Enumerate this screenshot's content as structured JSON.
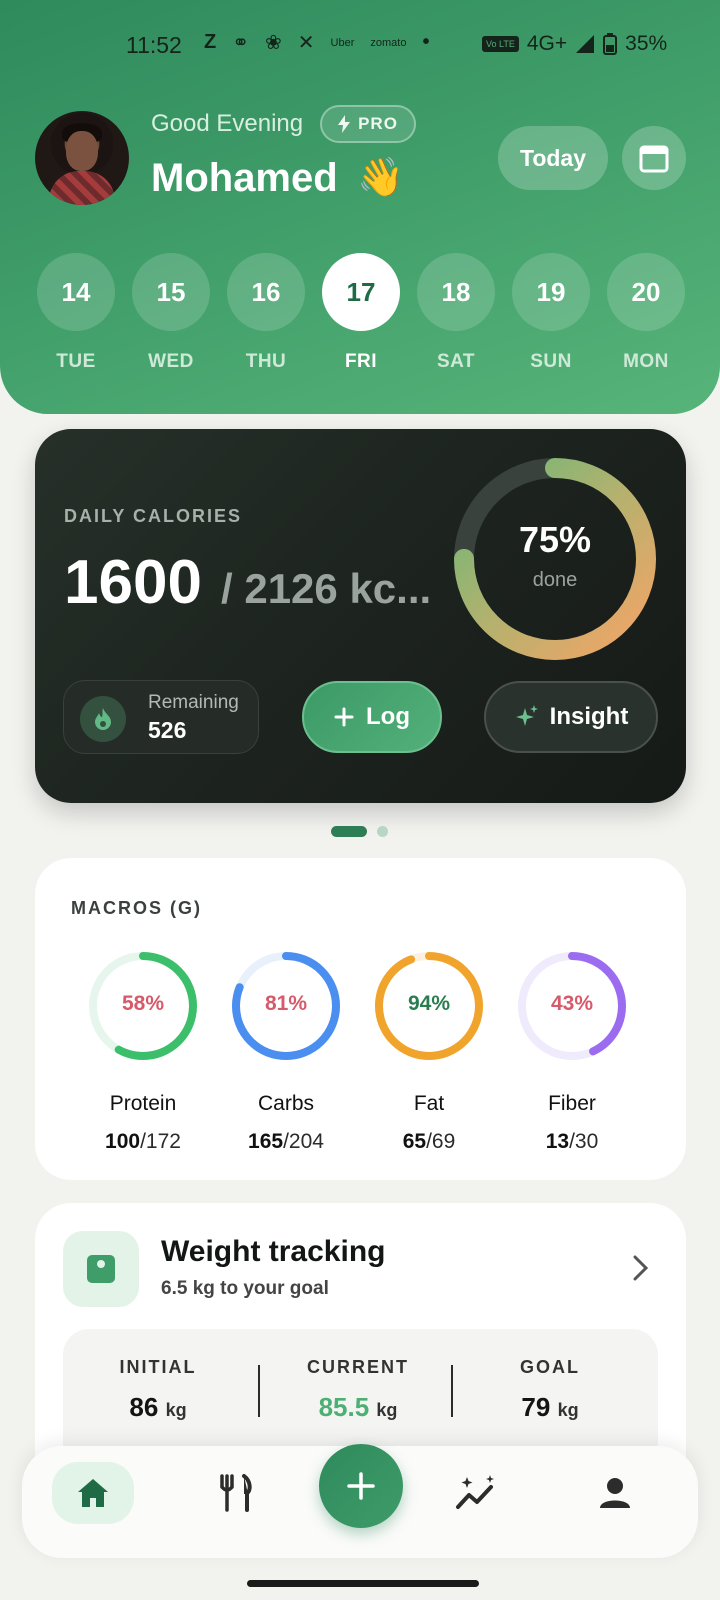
{
  "status_bar": {
    "time": "11:52",
    "apps": [
      "Z",
      "Uber",
      "zomato"
    ],
    "network": "4G+",
    "battery": "35%",
    "volte": "Vo LTE"
  },
  "header": {
    "greeting": "Good Evening",
    "badge": "PRO",
    "user_name": "Mohamed",
    "wave_emoji": "👋",
    "today_label": "Today",
    "days": [
      {
        "num": "14",
        "label": "TUE",
        "selected": false
      },
      {
        "num": "15",
        "label": "WED",
        "selected": false
      },
      {
        "num": "16",
        "label": "THU",
        "selected": false
      },
      {
        "num": "17",
        "label": "FRI",
        "selected": true
      },
      {
        "num": "18",
        "label": "SAT",
        "selected": false
      },
      {
        "num": "19",
        "label": "SUN",
        "selected": false
      },
      {
        "num": "20",
        "label": "MON",
        "selected": false
      }
    ]
  },
  "calories": {
    "label": "DAILY CALORIES",
    "consumed": "1600",
    "goal_text": "/ 2126 kc...",
    "percent_text": "75%",
    "percent_value": 0.75,
    "done_label": "done",
    "remaining_label": "Remaining",
    "remaining_value": "526",
    "log_label": "Log",
    "insight_label": "Insight"
  },
  "macros": {
    "title": "MACROS (G)",
    "items": [
      {
        "name": "Protein",
        "pct": "58%",
        "fraction": 0.58,
        "current": "100",
        "goal": "/172",
        "color": "#3cbf6a",
        "track": "#e6f6ec",
        "text_color": "#d65a6a"
      },
      {
        "name": "Carbs",
        "pct": "81%",
        "fraction": 0.81,
        "current": "165",
        "goal": "/204",
        "color": "#4a8ef0",
        "track": "#e8f0fc",
        "text_color": "#d65a6a"
      },
      {
        "name": "Fat",
        "pct": "94%",
        "fraction": 0.94,
        "current": "65",
        "goal": "/69",
        "color": "#f0a42c",
        "track": "#fcf1de",
        "text_color": "#2a7d4e"
      },
      {
        "name": "Fiber",
        "pct": "43%",
        "fraction": 0.43,
        "current": "13",
        "goal": "/30",
        "color": "#9b6cf0",
        "track": "#efeafc",
        "text_color": "#d65a6a"
      }
    ]
  },
  "weight": {
    "title": "Weight tracking",
    "subtitle": "6.5 kg to your goal",
    "initial_label": "INITIAL",
    "initial_value": "86",
    "current_label": "CURRENT",
    "current_value": "85.5",
    "goal_label": "GOAL",
    "goal_value": "79",
    "unit": "kg"
  },
  "colors": {
    "brand": "#2f8a5c",
    "accent": "#4caf74"
  },
  "icons": [
    "calendar-icon",
    "flame-icon",
    "plus-icon",
    "sparkle-icon",
    "scale-icon",
    "chevron-right-icon",
    "home-icon",
    "fork-knife-icon",
    "trend-icon",
    "person-icon"
  ]
}
